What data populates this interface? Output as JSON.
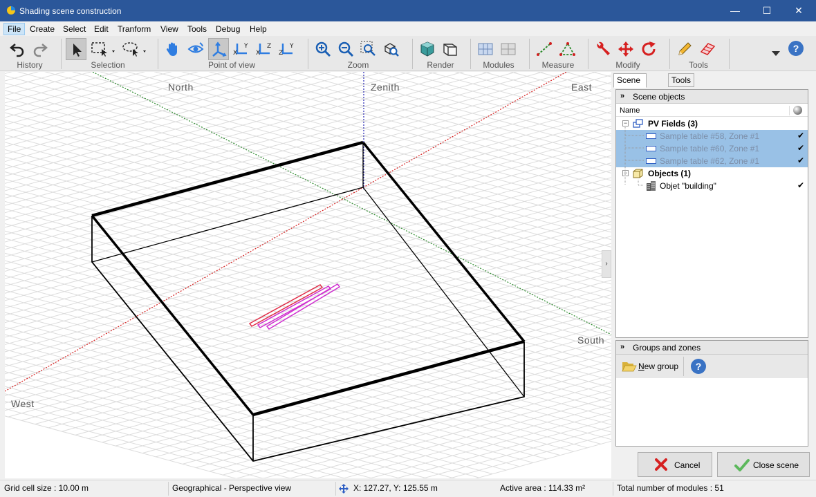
{
  "window": {
    "title": "Shading scene construction",
    "controls": [
      "—",
      "☐",
      "✕"
    ]
  },
  "menu": [
    "File",
    "Create",
    "Select",
    "Edit",
    "Tranform",
    "View",
    "Tools",
    "Debug",
    "Help"
  ],
  "toolbar": {
    "groups": {
      "history": "History",
      "selection": "Selection",
      "point_of_view": "Point of view",
      "zoom": "Zoom",
      "render": "Render",
      "modules": "Modules",
      "measure": "Measure",
      "modify": "Modify",
      "tools": "Tools"
    },
    "axis_labels": {
      "xy_a": "X",
      "xy_b": "Y",
      "xz_a": "X",
      "xz_b": "Z",
      "zy_a": "Z",
      "zy_b": "Y"
    },
    "help": "?"
  },
  "viewport": {
    "north": "North",
    "zenith": "Zenith",
    "east": "East",
    "south": "South",
    "west": "West",
    "collapse": "›"
  },
  "right_panel": {
    "tabs": [
      "Scene objects",
      "Tools"
    ],
    "scene_objects_header": "Scene objects",
    "column_name": "Name",
    "tree": {
      "pv_fields": "PV Fields (3)",
      "tables": [
        "Sample table #58, Zone #1",
        "Sample table #60, Zone #1",
        "Sample table #62, Zone #1"
      ],
      "objects": "Objects (1)",
      "building": "Objet \"building\"",
      "check": "✔",
      "expander": "−"
    },
    "groups_header": "Groups and zones",
    "new_group_prefix": "N",
    "new_group_rest": "ew group",
    "help": "?"
  },
  "buttons": {
    "cancel": "Cancel",
    "close_scene": "Close scene"
  },
  "status": {
    "grid": "Grid cell size : 10.00 m",
    "view": "Geographical - Perspective view",
    "coords": "X: 127.27, Y: 125.55 m",
    "area": "Active area : 114.33 m²",
    "modules": "Total number of modules : 51"
  },
  "colors": {
    "titlebar": "#2b579a",
    "selection": "#99c1e6",
    "axis_north_south": "#2e8b2e",
    "axis_east_west": "#d62020",
    "axis_zenith": "#2020b0",
    "pv_table_red": "#e0304a",
    "pv_table_magenta": "#d030d0"
  }
}
